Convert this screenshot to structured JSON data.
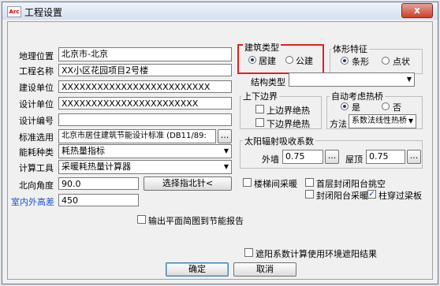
{
  "window": {
    "title": "工程设置",
    "close_label": "x",
    "icon_label": "Arc"
  },
  "left": {
    "location_label": "地理位置",
    "location_value": "北京市-北京",
    "project_name_label": "工程名称",
    "project_name_value": "XX小区花园项目2号楼",
    "build_unit_label": "建设单位",
    "build_unit_value": "XXXXXXXXXXXXXXXXXXXXXXXXX",
    "design_unit_label": "设计单位",
    "design_unit_value": "XXXXXXXXXXXXXXXXXXXXXXX",
    "design_no_label": "设计编号",
    "design_no_value": "",
    "standard_label": "标准选用",
    "standard_value": "北京市居住建筑节能设计标准 (DB11/89:",
    "energy_type_label": "能耗种类",
    "energy_type_value": "耗热量指标",
    "calc_tool_label": "计算工具",
    "calc_tool_value": "采暖耗热量计算器",
    "north_angle_label": "北向角度",
    "north_angle_value": "90.0",
    "north_button": "选择指北针<",
    "height_diff_label": "室内外高差",
    "height_diff_value": "450",
    "export_label": "输出平面简图到节能报告"
  },
  "right": {
    "building_type_title": "建筑类型",
    "residential": "居建",
    "public": "公建",
    "shape_title": "体形特征",
    "strip": "条形",
    "point": "点状",
    "struct_type_label": "结构类型",
    "struct_type_value": "",
    "boundary_title": "上下边界",
    "upper_insul": "上边界绝热",
    "lower_insul": "下边界绝热",
    "thermal_bridge_title": "自动考虑热桥",
    "yes": "是",
    "no": "否",
    "method_label": "方法",
    "method_value": "系数法线性热桥",
    "solar_title": "太阳辐射吸收系数",
    "outer_wall_label": "外墙",
    "outer_wall_value": "0.75",
    "roof_label": "屋顶",
    "roof_value": "0.75",
    "stair_heating": "楼梯间采暖",
    "first_floor_balcony": "首层封闭阳台挑空",
    "closed_balcony_heating": "封闭阳台采暖",
    "column_beam": "柱穿过梁板",
    "shading_label": "遮阳系数计算使用环境遮阳结果"
  },
  "buttons": {
    "ok": "确定",
    "cancel": "取消",
    "ellipsis": "..."
  },
  "colors": {
    "accent": "#1d3a8a",
    "highlight": "#e02020",
    "link_label": "#1a4fd6"
  }
}
